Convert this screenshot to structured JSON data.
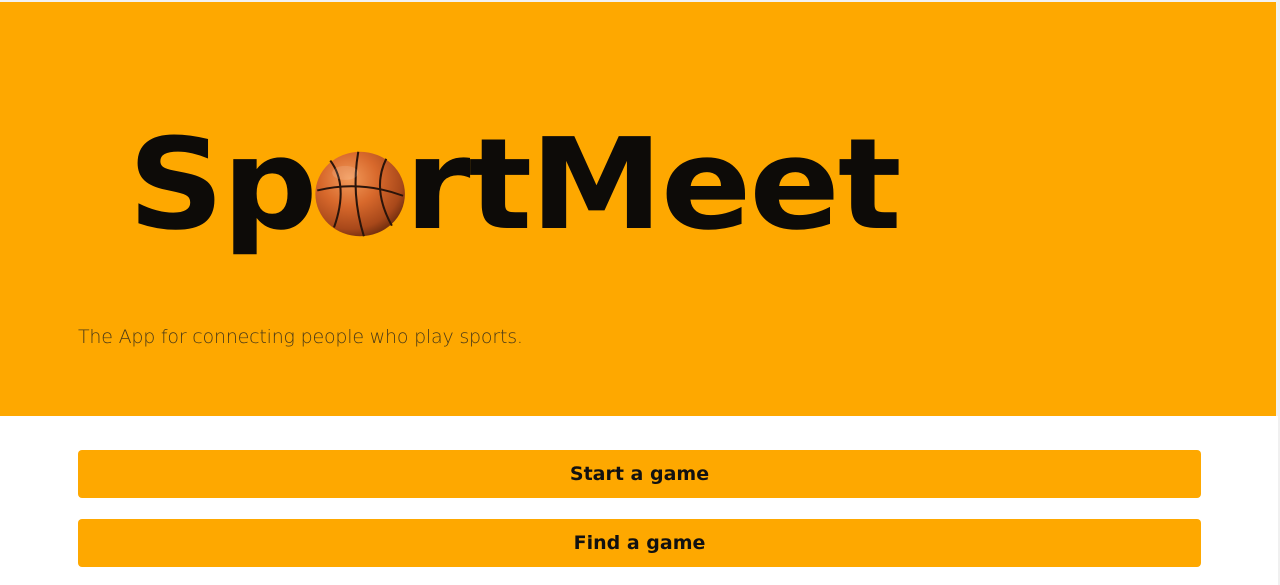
{
  "hero": {
    "logo": {
      "text_before": "Sp",
      "text_after": "rtMeet",
      "ball_icon": "basketball-icon"
    },
    "tagline": "The App for connecting people who play sports."
  },
  "actions": {
    "start_label": "Start a game",
    "find_label": "Find a game"
  },
  "colors": {
    "brand_orange": "#fea800",
    "text_dark": "#0d0b08"
  }
}
